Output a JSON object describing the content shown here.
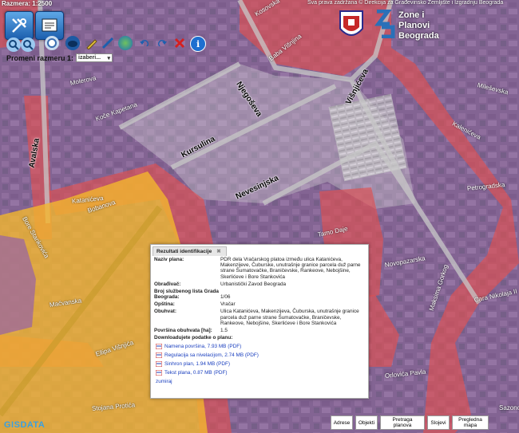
{
  "header": {
    "scale_label": "Razmera: 1:2500",
    "copyright": "Sva prava zadržana © Direkcija za Građevinsko Zemljište i Izgradnju Beograda"
  },
  "toolbar": {
    "tools": [
      "tools-icon",
      "layers-icon",
      "zoom-in-icon",
      "zoom-out-icon",
      "zoom-window-icon",
      "pan-icon",
      "pencil-icon",
      "measure-icon",
      "globe-icon",
      "undo-icon",
      "redo-icon",
      "clear-icon",
      "info-icon"
    ],
    "scale_label": "Promeni razmeru 1:",
    "scale_select": "izaberi..."
  },
  "logo": {
    "line1": "Zone i",
    "line2": "Planovi",
    "line3": "Beograda"
  },
  "streets": [
    "Kosovska",
    "Baba Višnjina",
    "Njegoševa",
    "Višnjićeva",
    "Koče Kapetana",
    "Molerova",
    "Avalska",
    "Kursulina",
    "Nevesinjska",
    "Katanićeva",
    "Bore Stankovića",
    "Mačvanska",
    "Ellipa Višnjića",
    "Stojana Protića",
    "Kalenićeva",
    "Mileševska",
    "Petrogradska",
    "Novopazarska",
    "Maksima Gorkog",
    "Cara Nikolaja II",
    "Orlovića Pavla",
    "Sazonova",
    "Tamo Daje",
    "Bobanova"
  ],
  "colors": {
    "zone_red": "#e05050",
    "zone_purple": "#8a56b8",
    "zone_yellow": "#f2b62e",
    "link_blue": "#1a3fbf"
  },
  "popup": {
    "tab_title": "Rezultati identifikacije",
    "close": "✖",
    "rows": [
      {
        "key": "Naziv plana:",
        "value": "PDR dela Vračarskog platoa između ulica Katanićeva, Makenzijeve, Čuburske, unutrašnje granice parcela duž parne strane Šumatovačke, Braničevske, Rankeove, Nebojšine, Skerlićeve i Bore Stankovića"
      },
      {
        "key": "Obrađivač:",
        "value": "Urbanistički Zavod Beograda"
      },
      {
        "key": "Broj službenog lista Grada Beograda:",
        "value": "1/06"
      },
      {
        "key": "Opština:",
        "value": "Vračar"
      },
      {
        "key": "Obuhvat:",
        "value": "Ulica Katanićeva, Makenzijeva, Čuburska, unutrašnje granice parcela duž parne strane Šumatovačke, Braničevske, Rankeove, Nebojšine, Skerlićeve i Bore Stankovića"
      },
      {
        "key": "Površina obuhvata [ha]:",
        "value": "1.5"
      }
    ],
    "download_title": "Downloadujete podatke o planu:",
    "downloads": [
      "Namena površina, 7.93 MB (PDF)",
      "Regulacija sa nivelacijom, 2.74 MB (PDF)",
      "Sinhron plan, 1.94 MB (PDF)",
      "Tekst plana, 0.87 MB (PDF)"
    ],
    "zoom_link": "zumiraj"
  },
  "bottom_buttons": [
    "Adrese",
    "Objekti",
    "Pretraga planova",
    "Slojevi",
    "Pregledna mapa"
  ],
  "footer_logo": "GISDATA"
}
